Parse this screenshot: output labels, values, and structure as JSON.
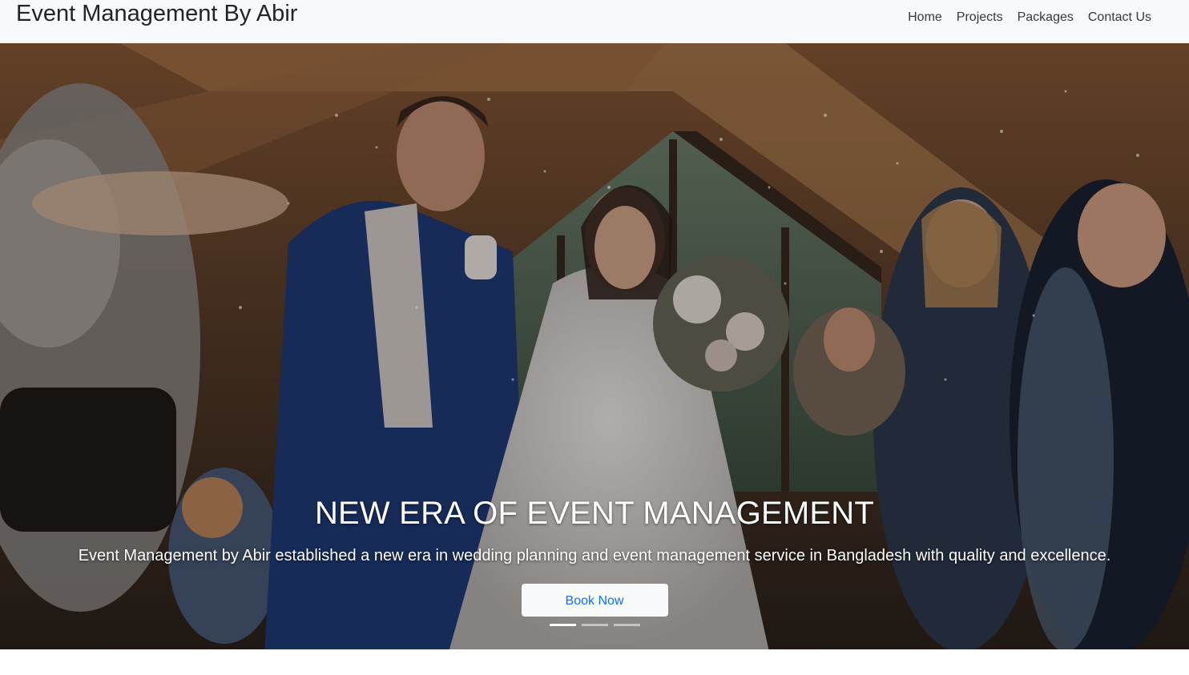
{
  "navbar": {
    "brand": "Event Management By Abir",
    "links": [
      {
        "label": "Home"
      },
      {
        "label": "Projects"
      },
      {
        "label": "Packages"
      },
      {
        "label": "Contact Us"
      }
    ]
  },
  "hero": {
    "image": "wedding-couple-confetti-photo",
    "title": "NEW ERA OF EVENT MANAGEMENT",
    "text": "Event Management by Abir established a new era in wedding planning and event management service in Bangladesh with quality and excellence.",
    "button_label": "Book Now",
    "slides": 3,
    "active_slide": 1
  },
  "colors": {
    "navbar_bg": "#f8f9fa",
    "brand_text": "#212529",
    "button_text": "#0d6efd",
    "caption_text": "#ffffff"
  }
}
